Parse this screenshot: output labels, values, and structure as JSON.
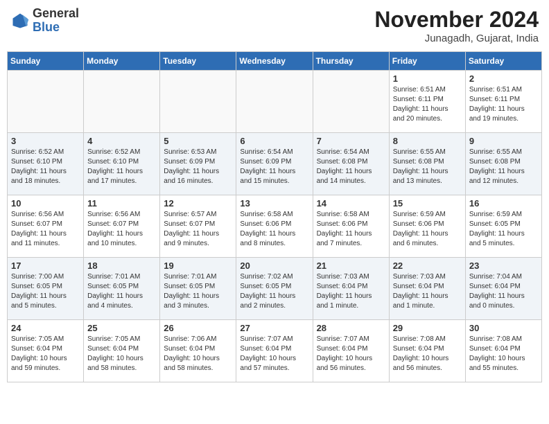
{
  "header": {
    "logo_general": "General",
    "logo_blue": "Blue",
    "month_title": "November 2024",
    "location": "Junagadh, Gujarat, India"
  },
  "days_of_week": [
    "Sunday",
    "Monday",
    "Tuesday",
    "Wednesday",
    "Thursday",
    "Friday",
    "Saturday"
  ],
  "weeks": [
    [
      {
        "day": "",
        "info": ""
      },
      {
        "day": "",
        "info": ""
      },
      {
        "day": "",
        "info": ""
      },
      {
        "day": "",
        "info": ""
      },
      {
        "day": "",
        "info": ""
      },
      {
        "day": "1",
        "info": "Sunrise: 6:51 AM\nSunset: 6:11 PM\nDaylight: 11 hours\nand 20 minutes."
      },
      {
        "day": "2",
        "info": "Sunrise: 6:51 AM\nSunset: 6:11 PM\nDaylight: 11 hours\nand 19 minutes."
      }
    ],
    [
      {
        "day": "3",
        "info": "Sunrise: 6:52 AM\nSunset: 6:10 PM\nDaylight: 11 hours\nand 18 minutes."
      },
      {
        "day": "4",
        "info": "Sunrise: 6:52 AM\nSunset: 6:10 PM\nDaylight: 11 hours\nand 17 minutes."
      },
      {
        "day": "5",
        "info": "Sunrise: 6:53 AM\nSunset: 6:09 PM\nDaylight: 11 hours\nand 16 minutes."
      },
      {
        "day": "6",
        "info": "Sunrise: 6:54 AM\nSunset: 6:09 PM\nDaylight: 11 hours\nand 15 minutes."
      },
      {
        "day": "7",
        "info": "Sunrise: 6:54 AM\nSunset: 6:08 PM\nDaylight: 11 hours\nand 14 minutes."
      },
      {
        "day": "8",
        "info": "Sunrise: 6:55 AM\nSunset: 6:08 PM\nDaylight: 11 hours\nand 13 minutes."
      },
      {
        "day": "9",
        "info": "Sunrise: 6:55 AM\nSunset: 6:08 PM\nDaylight: 11 hours\nand 12 minutes."
      }
    ],
    [
      {
        "day": "10",
        "info": "Sunrise: 6:56 AM\nSunset: 6:07 PM\nDaylight: 11 hours\nand 11 minutes."
      },
      {
        "day": "11",
        "info": "Sunrise: 6:56 AM\nSunset: 6:07 PM\nDaylight: 11 hours\nand 10 minutes."
      },
      {
        "day": "12",
        "info": "Sunrise: 6:57 AM\nSunset: 6:07 PM\nDaylight: 11 hours\nand 9 minutes."
      },
      {
        "day": "13",
        "info": "Sunrise: 6:58 AM\nSunset: 6:06 PM\nDaylight: 11 hours\nand 8 minutes."
      },
      {
        "day": "14",
        "info": "Sunrise: 6:58 AM\nSunset: 6:06 PM\nDaylight: 11 hours\nand 7 minutes."
      },
      {
        "day": "15",
        "info": "Sunrise: 6:59 AM\nSunset: 6:06 PM\nDaylight: 11 hours\nand 6 minutes."
      },
      {
        "day": "16",
        "info": "Sunrise: 6:59 AM\nSunset: 6:05 PM\nDaylight: 11 hours\nand 5 minutes."
      }
    ],
    [
      {
        "day": "17",
        "info": "Sunrise: 7:00 AM\nSunset: 6:05 PM\nDaylight: 11 hours\nand 5 minutes."
      },
      {
        "day": "18",
        "info": "Sunrise: 7:01 AM\nSunset: 6:05 PM\nDaylight: 11 hours\nand 4 minutes."
      },
      {
        "day": "19",
        "info": "Sunrise: 7:01 AM\nSunset: 6:05 PM\nDaylight: 11 hours\nand 3 minutes."
      },
      {
        "day": "20",
        "info": "Sunrise: 7:02 AM\nSunset: 6:05 PM\nDaylight: 11 hours\nand 2 minutes."
      },
      {
        "day": "21",
        "info": "Sunrise: 7:03 AM\nSunset: 6:04 PM\nDaylight: 11 hours\nand 1 minute."
      },
      {
        "day": "22",
        "info": "Sunrise: 7:03 AM\nSunset: 6:04 PM\nDaylight: 11 hours\nand 1 minute."
      },
      {
        "day": "23",
        "info": "Sunrise: 7:04 AM\nSunset: 6:04 PM\nDaylight: 11 hours\nand 0 minutes."
      }
    ],
    [
      {
        "day": "24",
        "info": "Sunrise: 7:05 AM\nSunset: 6:04 PM\nDaylight: 10 hours\nand 59 minutes."
      },
      {
        "day": "25",
        "info": "Sunrise: 7:05 AM\nSunset: 6:04 PM\nDaylight: 10 hours\nand 58 minutes."
      },
      {
        "day": "26",
        "info": "Sunrise: 7:06 AM\nSunset: 6:04 PM\nDaylight: 10 hours\nand 58 minutes."
      },
      {
        "day": "27",
        "info": "Sunrise: 7:07 AM\nSunset: 6:04 PM\nDaylight: 10 hours\nand 57 minutes."
      },
      {
        "day": "28",
        "info": "Sunrise: 7:07 AM\nSunset: 6:04 PM\nDaylight: 10 hours\nand 56 minutes."
      },
      {
        "day": "29",
        "info": "Sunrise: 7:08 AM\nSunset: 6:04 PM\nDaylight: 10 hours\nand 56 minutes."
      },
      {
        "day": "30",
        "info": "Sunrise: 7:08 AM\nSunset: 6:04 PM\nDaylight: 10 hours\nand 55 minutes."
      }
    ]
  ]
}
